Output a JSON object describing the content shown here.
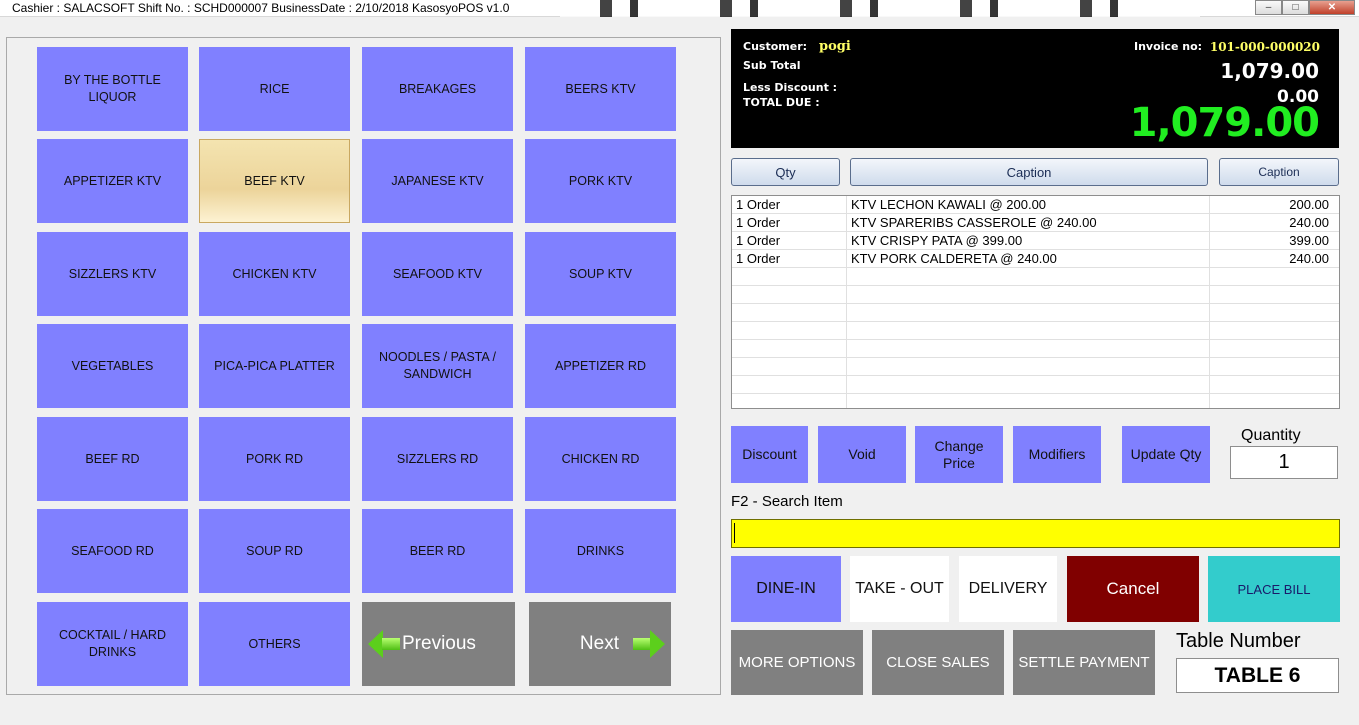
{
  "window": {
    "title": "Cashier : SALACSOFT Shift No. : SCHD000007 BusinessDate : 2/10/2018  KasosyoPOS v1.0",
    "minimize": "–",
    "maximize": "□",
    "close": "✕"
  },
  "categories": [
    "BY THE BOTTLE LIQUOR",
    "RICE",
    "BREAKAGES",
    "BEERS KTV",
    "APPETIZER KTV",
    "BEEF KTV",
    "JAPANESE KTV",
    "PORK KTV",
    "SIZZLERS KTV",
    "CHICKEN KTV",
    "SEAFOOD KTV",
    "SOUP KTV",
    "VEGETABLES",
    "PICA-PICA PLATTER",
    "NOODLES / PASTA / SANDWICH",
    "APPETIZER RD",
    "BEEF RD",
    "PORK RD",
    "SIZZLERS RD",
    "CHICKEN RD",
    "SEAFOOD RD",
    "SOUP RD",
    "BEER RD",
    "DRINKS",
    "COCKTAIL / HARD DRINKS",
    "OTHERS"
  ],
  "selected_category": "BEEF KTV",
  "nav": {
    "previous": "Previous",
    "next": "Next"
  },
  "totals": {
    "customer_label": "Customer:",
    "customer": "pogi",
    "invoice_label": "Invoice no:",
    "invoice": "101-000-000020",
    "subtotal_label": "Sub Total",
    "subtotal": "1,079.00",
    "discount_label": "Less Discount :",
    "discount": "0.00",
    "total_label": "TOTAL DUE   :",
    "total": "1,079.00",
    "total_color": "#21ee21"
  },
  "order_headers": {
    "qty": "Qty",
    "caption1": "Caption",
    "caption2": "Caption"
  },
  "orders": [
    {
      "qty": "1 Order",
      "item": "KTV LECHON KAWALI @ 200.00",
      "amount": "200.00"
    },
    {
      "qty": "1 Order",
      "item": "KTV SPARERIBS CASSEROLE @ 240.00",
      "amount": "240.00"
    },
    {
      "qty": "1 Order",
      "item": "KTV CRISPY PATA @ 399.00",
      "amount": "399.00"
    },
    {
      "qty": "1 Order",
      "item": "KTV PORK CALDERETA @ 240.00",
      "amount": "240.00"
    }
  ],
  "actions": {
    "discount": "Discount",
    "void": "Void",
    "change_price": "Change Price",
    "modifiers": "Modifiers",
    "update_qty": "Update Qty"
  },
  "quantity": {
    "label": "Quantity",
    "value": "1"
  },
  "search": {
    "label": "F2 - Search Item",
    "value": ""
  },
  "order_type": {
    "dine_in": "DINE-IN",
    "take_out": "TAKE - OUT",
    "delivery": "DELIVERY",
    "cancel": "Cancel",
    "place_bill": "PLACE BILL"
  },
  "bottom": {
    "more_options": "MORE OPTIONS",
    "close_sales": "CLOSE SALES",
    "settle_payment": "SETTLE PAYMENT"
  },
  "table": {
    "label": "Table Number",
    "value": "TABLE 6"
  },
  "colors": {
    "category_button": "#8080ff",
    "nav_button": "#808080",
    "cancel": "#800000",
    "place_bill": "#33cccc",
    "search_bg": "#ffff00"
  }
}
